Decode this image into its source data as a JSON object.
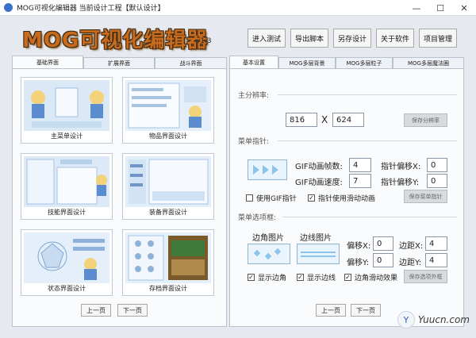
{
  "titlebar": {
    "title": "MOG可视化编辑器  当前设计工程【默认设计】",
    "min": "—",
    "max": "☐",
    "close": "✕"
  },
  "header": {
    "logo": "MOG可视化编辑器",
    "version": "v1.3",
    "buttons": [
      "进入测试",
      "导出脚本",
      "另存设计",
      "关于软件",
      "项目管理"
    ]
  },
  "left_panel": {
    "tabs": [
      "基础界面",
      "扩展界面",
      "战斗界面"
    ],
    "active_tab": 0,
    "thumbnails": [
      "主菜单设计",
      "物品界面设计",
      "技能界面设计",
      "装备界面设计",
      "状态界面设计",
      "存档界面设计"
    ],
    "prev": "上一页",
    "next": "下一页"
  },
  "right_panel": {
    "tabs": [
      "基本设置",
      "MOG多层背景",
      "MOG多层粒子",
      "MOG多层魔法圈"
    ],
    "active_tab": 0,
    "resolution": {
      "section": "主分辨率:",
      "width": "816",
      "x": "X",
      "height": "624",
      "save": "保存分辨率"
    },
    "pointer": {
      "section": "菜单指针:",
      "gif_frames_label": "GIF动画帧数:",
      "gif_frames": "4",
      "gif_speed_label": "GIF动画速度:",
      "gif_speed": "7",
      "offset_x_label": "指针偏移X:",
      "offset_x": "0",
      "offset_y_label": "指针偏移Y:",
      "offset_y": "0",
      "use_gif": "使用GIF指针",
      "use_gif_checked": false,
      "slide": "指针使用滑动动画",
      "slide_checked": true,
      "save": "保存菜单指针"
    },
    "frame": {
      "section": "菜单选项框:",
      "corner_label": "边角图片",
      "border_label": "边线图片",
      "offset_x_label": "偏移X:",
      "offset_x": "0",
      "offset_y_label": "偏移Y:",
      "offset_y": "0",
      "margin_x_label": "边距X:",
      "margin_x": "4",
      "margin_y_label": "边距Y:",
      "margin_y": "4",
      "show_corner": "显示边角",
      "show_border": "显示边线",
      "slide": "边角滑动效果",
      "save": "保存选项外框"
    },
    "prev": "上一页",
    "next": "下一页"
  },
  "watermark": {
    "icon": "Y",
    "text": "Yuucn.com"
  }
}
